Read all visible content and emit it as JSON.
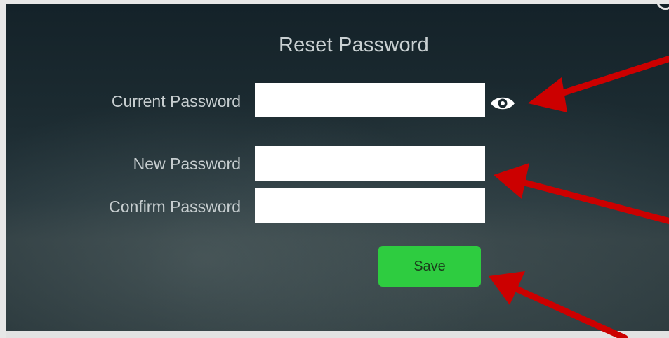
{
  "dialog": {
    "title": "Reset Password"
  },
  "form": {
    "current_password": {
      "label": "Current Password",
      "value": ""
    },
    "new_password": {
      "label": "New Password",
      "value": ""
    },
    "confirm_password": {
      "label": "Confirm Password",
      "value": ""
    },
    "save_label": "Save"
  },
  "icons": {
    "reveal": "eye-icon",
    "corner": "circle-icon",
    "annotations": "red-arrow"
  },
  "colors": {
    "save_button": "#2ecc40",
    "annotation_arrow": "#cc0000",
    "input_background": "#ffffff"
  }
}
